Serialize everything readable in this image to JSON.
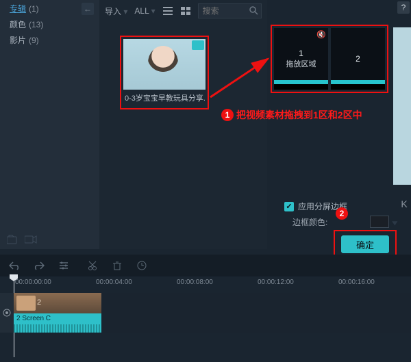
{
  "sidebar": {
    "items": [
      {
        "label": "专辑",
        "count": "(1)",
        "link": true
      },
      {
        "label": "颜色",
        "count": "(13)"
      },
      {
        "label": "影片",
        "count": "(9)"
      }
    ]
  },
  "browser": {
    "import_label": "导入",
    "all_label": "ALL",
    "search_placeholder": "搜索"
  },
  "thumbnail": {
    "caption": "0-3岁宝宝早教玩具分享..."
  },
  "zones": [
    {
      "num": "1",
      "label": "拖放区域"
    },
    {
      "num": "2",
      "label": ""
    }
  ],
  "ghost_k": "K",
  "annotations": {
    "a1": "把视频素材拖拽到1区和2区中",
    "b1": "1",
    "b2": "2"
  },
  "options": {
    "apply_border_label": "应用分屏边框",
    "border_color_label": "边框颜色:",
    "ok_label": "确定"
  },
  "ruler": {
    "ticks": [
      "00:00:00:00",
      "00:00:04:00",
      "00:00:08:00",
      "00:00:12:00",
      "00:00:16:00"
    ]
  },
  "clip": {
    "two": "2",
    "name": "2 Screen C"
  }
}
